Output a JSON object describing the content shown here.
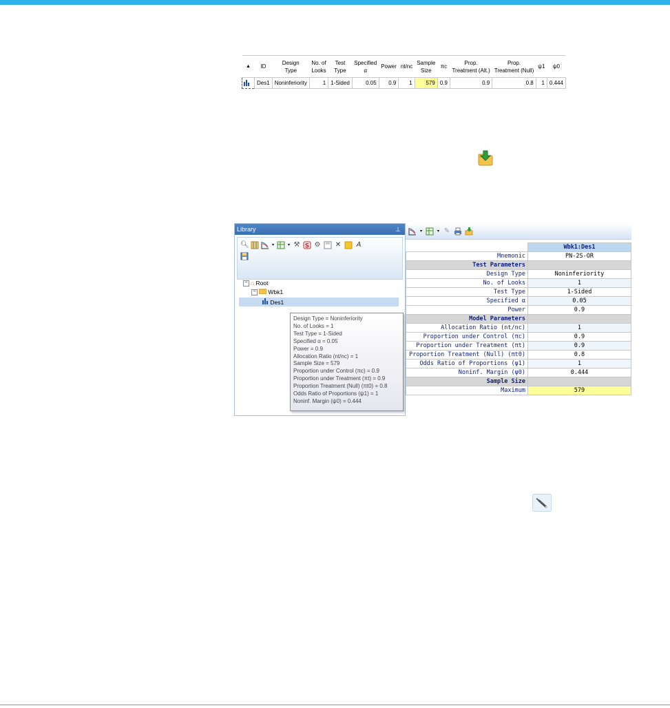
{
  "design_table": {
    "sort_icon": "sort-up-icon",
    "headers": [
      {
        "line1": "",
        "line2": "ID"
      },
      {
        "line1": "Design",
        "line2": "Type"
      },
      {
        "line1": "No. of",
        "line2": "Looks"
      },
      {
        "line1": "Test",
        "line2": "Type"
      },
      {
        "line1": "Specified",
        "line2": "α"
      },
      {
        "line1": "",
        "line2": "Power"
      },
      {
        "line1": "",
        "line2": "nt/nc"
      },
      {
        "line1": "Sample",
        "line2": "Size"
      },
      {
        "line1": "",
        "line2": "πc"
      },
      {
        "line1": "Prop.",
        "line2": "Treatment (Alt.)"
      },
      {
        "line1": "Prop.",
        "line2": "Treatment (Null)"
      },
      {
        "line1": "",
        "line2": "ψ1"
      },
      {
        "line1": "",
        "line2": "ψ0"
      }
    ],
    "row": {
      "id": "Des1",
      "design_type": "Noninferiority",
      "looks": "1",
      "test_type": "1-Sided",
      "alpha": "0.05",
      "power": "0.9",
      "ratio": "1",
      "sample_size": "579",
      "pic": "0.9",
      "prop_alt": "0.9",
      "prop_null": "0.8",
      "psi1": "1",
      "psi0": "0.444"
    }
  },
  "icons": {
    "save_to_workbook": "save-to-workbook-icon",
    "edit_design": "wrench-icon"
  },
  "library": {
    "title": "Library",
    "tree": {
      "root": "Root",
      "workbook": "Wbk1",
      "design": "Des1"
    },
    "tooltip": [
      "Design Type = Noninferiority",
      "No. of Looks = 1",
      "Test Type = 1-Sided",
      "Specified α = 0.05",
      "Power = 0.9",
      "Allocation Ratio (nt/nc) = 1",
      "Sample Size = 579",
      "Proportion under Control (πc) = 0.9",
      "Proportion under Treatment (πt) = 0.9",
      "Proportion Treatment (Null) (πt0) = 0.8",
      "Odds Ratio of Proportions (ψ1) = 1",
      "Noninf. Margin (ψ0) = 0.444"
    ]
  },
  "details": {
    "column_header": "Wbk1:Des1",
    "mnemonic_label": "Mnemonic",
    "mnemonic_value": "PN-2S-OR",
    "sections": {
      "test": "Test Parameters",
      "model": "Model Parameters",
      "sample": "Sample Size"
    },
    "test_params": [
      {
        "label": "Design Type",
        "value": "Noninferiority"
      },
      {
        "label": "No. of Looks",
        "value": "1"
      },
      {
        "label": "Test Type",
        "value": "1-Sided"
      },
      {
        "label": "Specified α",
        "value": "0.05"
      },
      {
        "label": "Power",
        "value": "0.9"
      }
    ],
    "model_params": [
      {
        "label": "Allocation Ratio (nt/nc)",
        "value": "1"
      },
      {
        "label": "Proportion under Control (πc)",
        "value": "0.9"
      },
      {
        "label": "Proportion under Treatment (πt)",
        "value": "0.9"
      },
      {
        "label": "Proportion Treatment (Null) (πt0)",
        "value": "0.8"
      },
      {
        "label": "Odds Ratio of Proportions (ψ1)",
        "value": "1"
      },
      {
        "label": "Noninf. Margin (ψ0)",
        "value": "0.444"
      }
    ],
    "sample": {
      "label": "Maximum",
      "value": "579"
    }
  },
  "colors": {
    "accent": "#2eb3e8",
    "highlight": "#ffff99",
    "header_blue": "#bcd7ef",
    "label_text": "#0f1f7a"
  }
}
